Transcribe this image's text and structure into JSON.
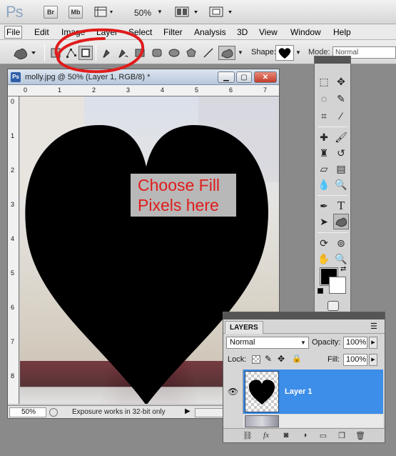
{
  "app": {
    "logo": "Ps",
    "bridge_label": "Br",
    "minibridge_label": "Mb",
    "zoom": "50%"
  },
  "menu": [
    "File",
    "Edit",
    "Image",
    "Layer",
    "Select",
    "Filter",
    "Analysis",
    "3D",
    "View",
    "Window",
    "Help"
  ],
  "options": {
    "shape_label": "Shape:",
    "mode_label": "Mode:",
    "mode_value": "Normal"
  },
  "document": {
    "title": "molly.jpg @ 50% (Layer 1, RGB/8) *",
    "icon": "Ps",
    "ruler_top": [
      "0",
      "1",
      "2",
      "3",
      "4",
      "5",
      "6",
      "7"
    ],
    "ruler_left": [
      "0",
      "1",
      "2",
      "3",
      "4",
      "5",
      "6",
      "7",
      "8"
    ],
    "zoom": "50%",
    "status": "Exposure works in 32-bit only"
  },
  "annotation": {
    "line1": "Choose Fill",
    "line2": "Pixels here",
    "color": "#e01c1c"
  },
  "layers": {
    "tab": "LAYERS",
    "blend_mode": "Normal",
    "opacity_label": "Opacity:",
    "opacity": "100%",
    "lock_label": "Lock:",
    "fill_label": "Fill:",
    "fill": "100%",
    "layer_name": "Layer 1",
    "selected_color": "#3d8ee8"
  },
  "colors": {
    "foreground": "#000000",
    "background": "#ffffff"
  }
}
